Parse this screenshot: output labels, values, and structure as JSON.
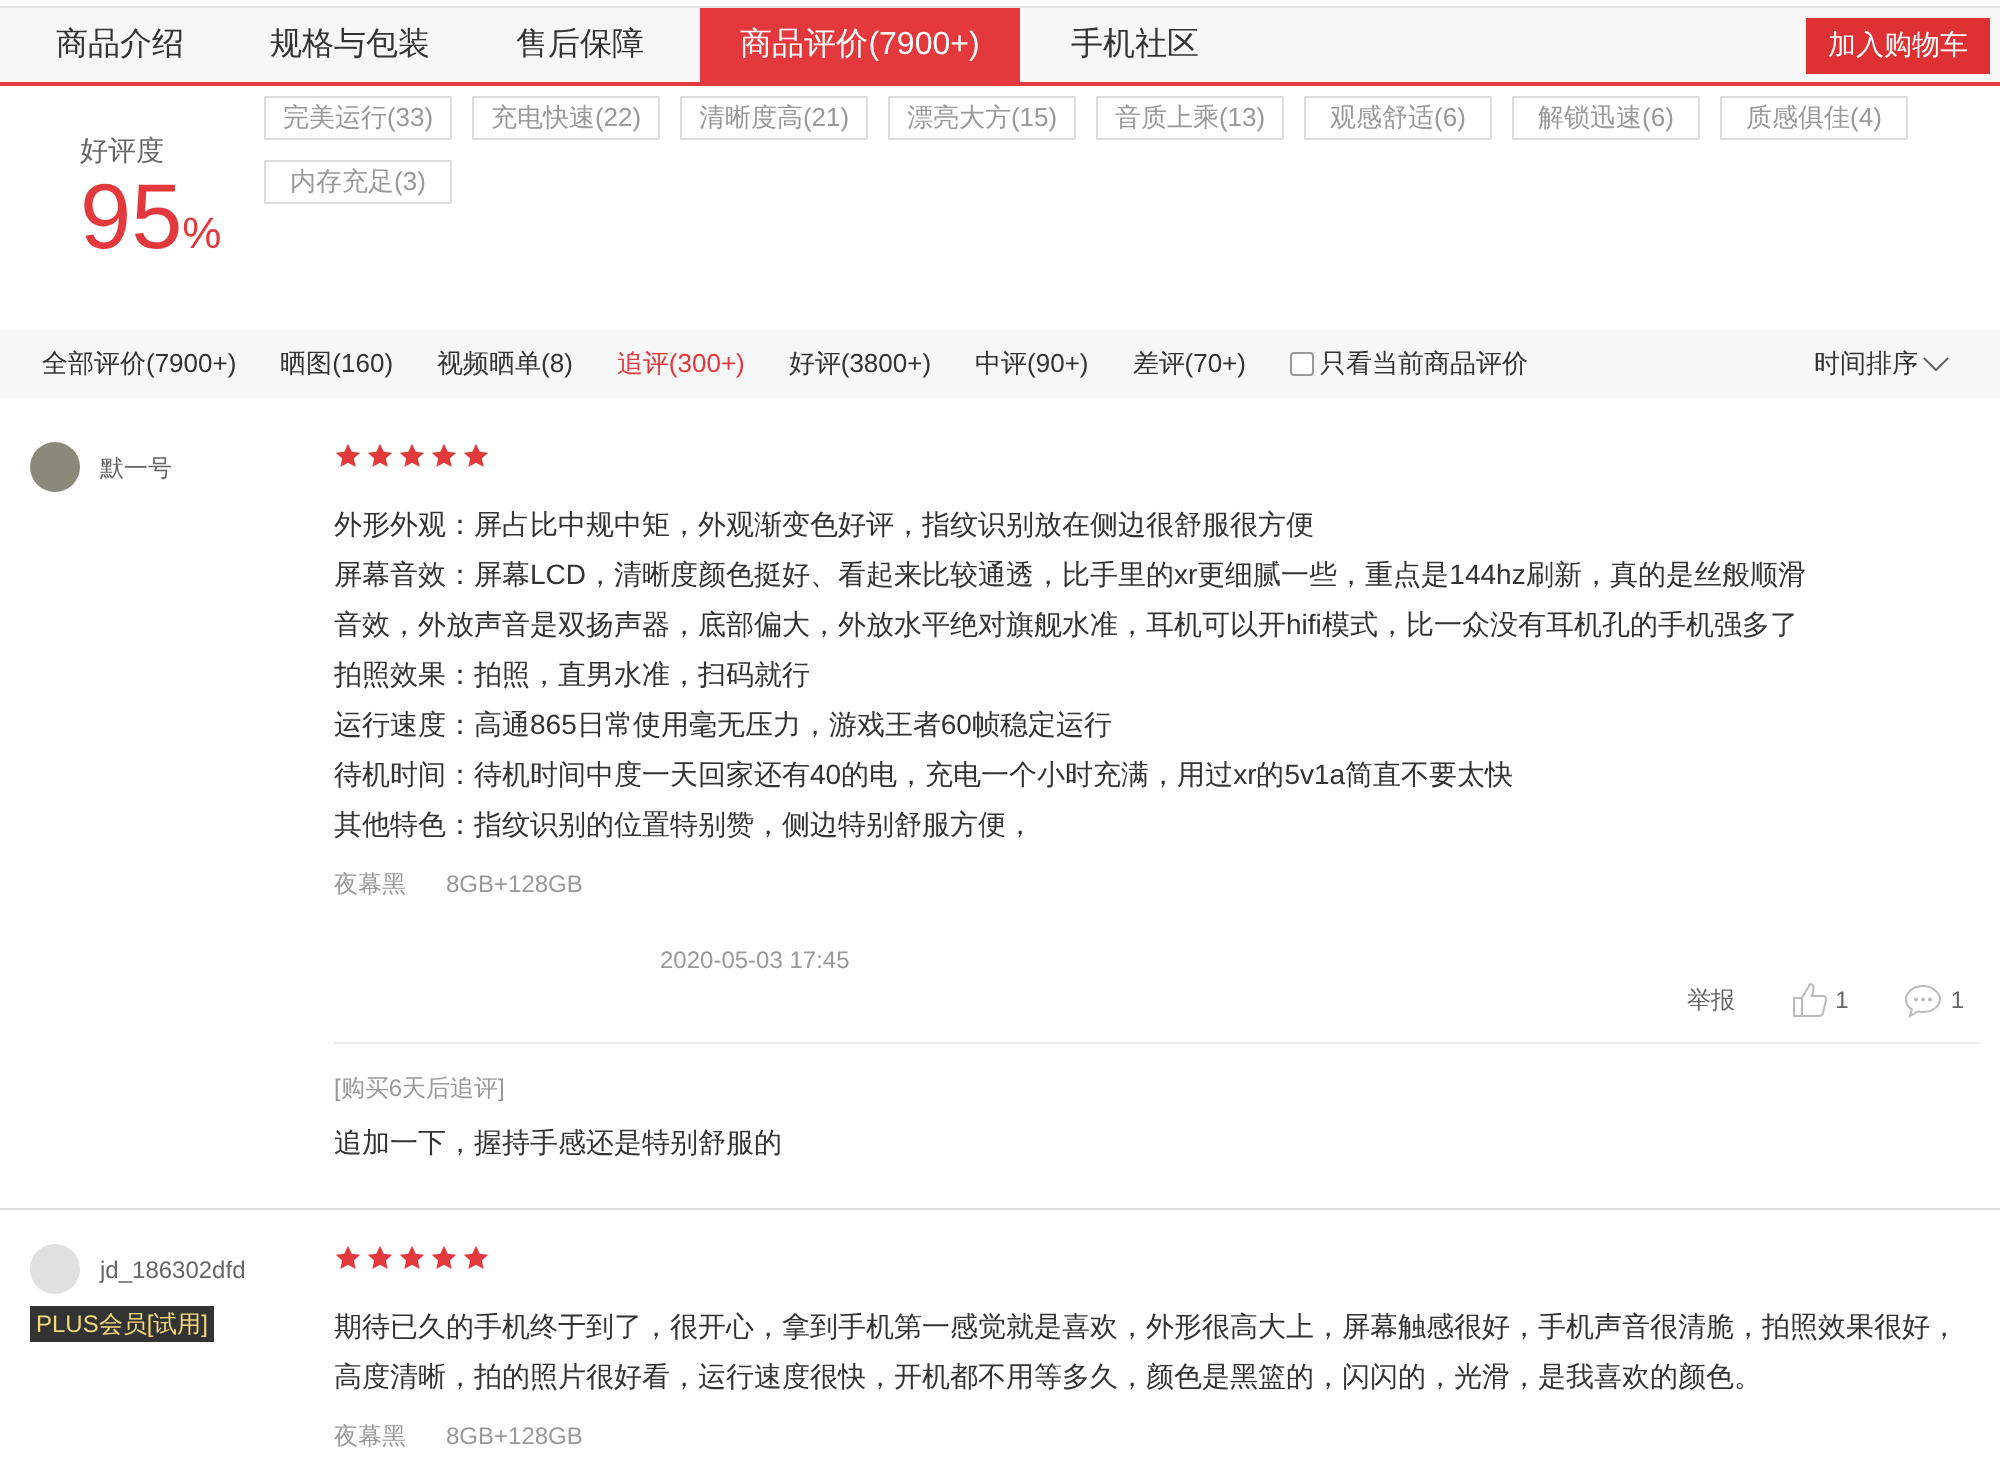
{
  "tabs": [
    {
      "label": "商品介绍",
      "selected": false
    },
    {
      "label": "规格与包装",
      "selected": false
    },
    {
      "label": "售后保障",
      "selected": false
    },
    {
      "label": "商品评价(7900+)",
      "selected": true
    },
    {
      "label": "手机社区",
      "selected": false
    }
  ],
  "cart_button": "加入购物车",
  "rating": {
    "label": "好评度",
    "value": "95",
    "unit": "%"
  },
  "tags": [
    "完美运行(33)",
    "充电快速(22)",
    "清晰度高(21)",
    "漂亮大方(15)",
    "音质上乘(13)",
    "观感舒适(6)",
    "解锁迅速(6)",
    "质感俱佳(4)",
    "内存充足(3)"
  ],
  "filters": [
    {
      "label": "全部评价(7900+)",
      "selected": false
    },
    {
      "label": "晒图(160)",
      "selected": false
    },
    {
      "label": "视频晒单(8)",
      "selected": false
    },
    {
      "label": "追评(300+)",
      "selected": true
    },
    {
      "label": "好评(3800+)",
      "selected": false
    },
    {
      "label": "中评(90+)",
      "selected": false
    },
    {
      "label": "差评(70+)",
      "selected": false
    }
  ],
  "only_current": {
    "label": "只看当前商品评价",
    "checked": false
  },
  "sort": "时间排序",
  "reviews": [
    {
      "user": "默一号",
      "stars": 5,
      "lines": [
        "外形外观：屏占比中规中矩，外观渐变色好评，指纹识别放在侧边很舒服很方便",
        "屏幕音效：屏幕LCD，清晰度颜色挺好、看起来比较通透，比手里的xr更细腻一些，重点是144hz刷新，真的是丝般顺滑",
        "音效，外放声音是双扬声器，底部偏大，外放水平绝对旗舰水准，耳机可以开hifi模式，比一众没有耳机孔的手机强多了",
        "拍照效果：拍照，直男水准，扫码就行",
        "运行速度：高通865日常使用毫无压力，游戏王者60帧稳定运行",
        "待机时间：待机时间中度一天回家还有40的电，充电一个小时充满，用过xr的5v1a简直不要太快",
        "其他特色：指纹识别的位置特别赞，侧边特别舒服方便，"
      ],
      "color_variant": "夜幕黑",
      "spec": "8GB+128GB",
      "date": "2020-05-03 17:45",
      "report": "举报",
      "likes": "1",
      "comments": "1",
      "followup": {
        "label": "[购买6天后追评]",
        "text": "追加一下，握持手感还是特别舒服的"
      }
    },
    {
      "user": "jd_186302dfd",
      "badge": "PLUS会员[试用]",
      "stars": 5,
      "lines": [
        "期待已久的手机终于到了，很开心，拿到手机第一感觉就是喜欢，外形很高大上，屏幕触感很好，手机声音很清脆，拍照效果很好，高度清晰，拍的照片很好看，运行速度很快，开机都不用等多久，颜色是黑篮的，闪闪的，光滑，是我喜欢的颜色。"
      ],
      "color_variant": "夜幕黑",
      "spec": "8GB+128GB"
    }
  ]
}
